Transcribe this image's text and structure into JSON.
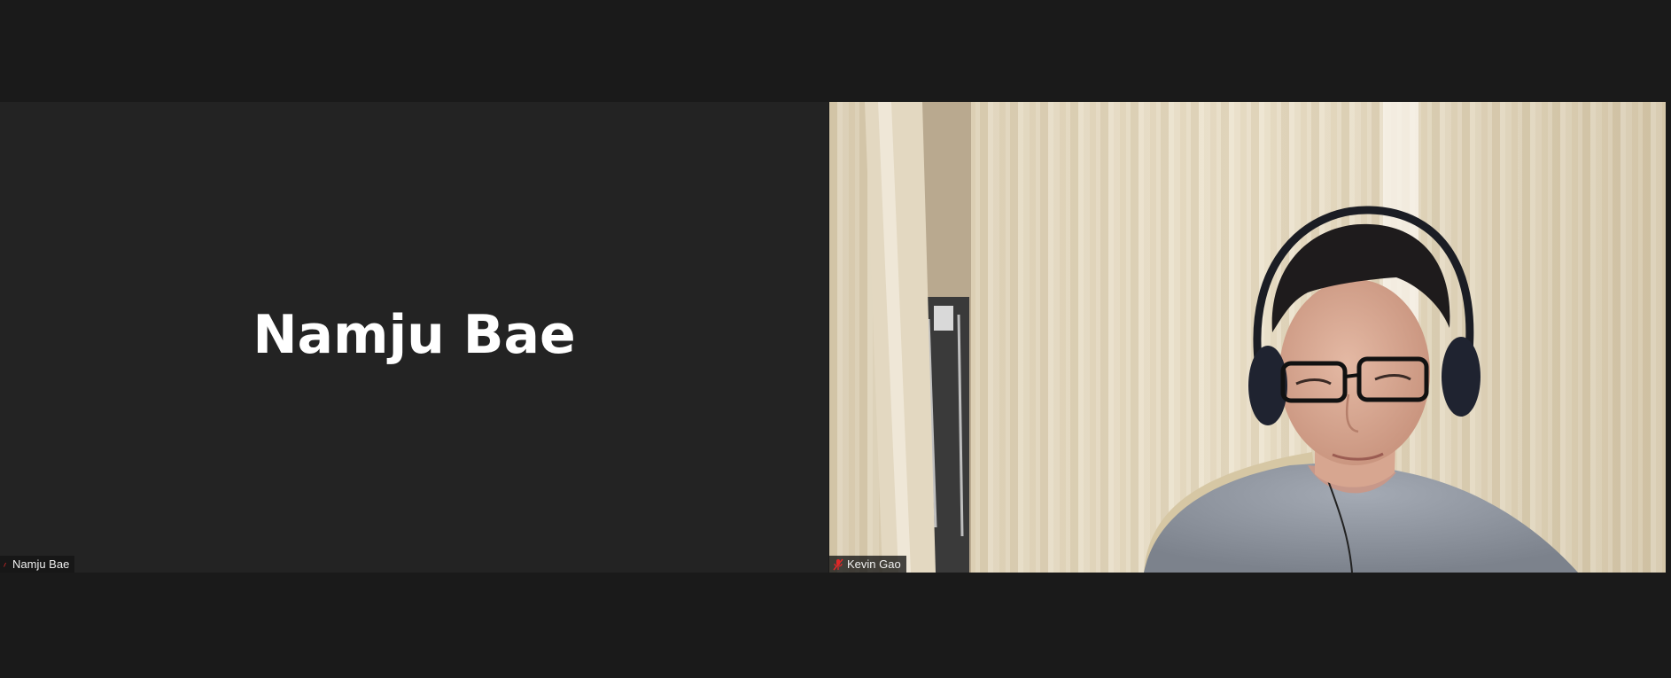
{
  "participants": [
    {
      "display_name": "Namju Bae",
      "label": "Namju Bae",
      "mic_icon": "mic-muted-small-icon",
      "video": false
    },
    {
      "label": "Kevin Gao",
      "mic_icon": "mic-muted-icon",
      "video": true
    }
  ],
  "colors": {
    "background": "#1a1a1a",
    "tile_background": "#232323",
    "muted_red": "#e02828"
  }
}
